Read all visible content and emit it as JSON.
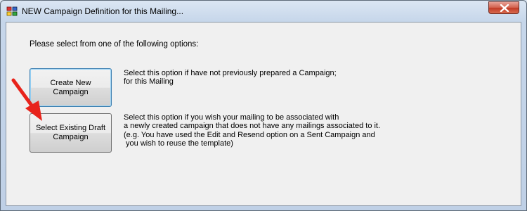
{
  "window": {
    "title": "NEW Campaign Definition for this Mailing..."
  },
  "prompt": "Please select from one of the following options:",
  "options": [
    {
      "button_line1": "Create New",
      "button_line2": "Campaign",
      "description": [
        "Select this option if have not previously prepared a Campaign;",
        "for this Mailing"
      ]
    },
    {
      "button_line1": "Select Existing Draft",
      "button_line2": "Campaign",
      "description": [
        "Select this option if you wish your mailing to be associated with",
        "a newly created campaign that does not have any mailings associated to it.",
        "(e.g. You have used the Edit and Resend option on a Sent Campaign and",
        " you wish to reuse the template)"
      ]
    }
  ],
  "colors": {
    "annotation_arrow": "#e8231b",
    "close_button": "#c13a26",
    "focused_button_border": "#3c7fb1"
  }
}
